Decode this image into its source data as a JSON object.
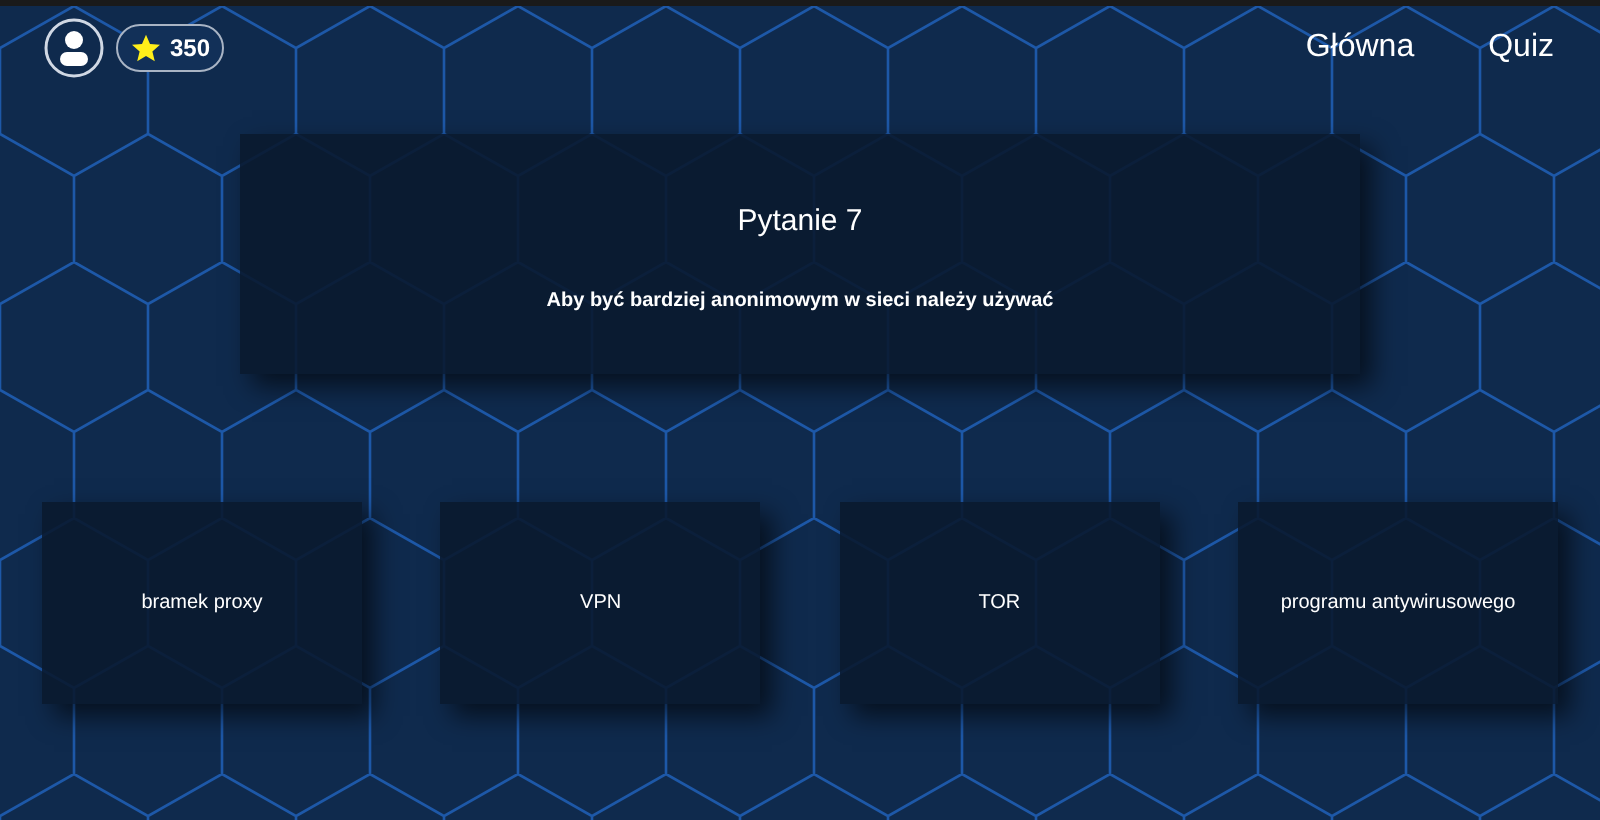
{
  "header": {
    "points": "350",
    "nav": [
      {
        "label": "Główna"
      },
      {
        "label": "Quiz"
      }
    ]
  },
  "question": {
    "title": "Pytanie 7",
    "text": "Aby być bardziej anonimowym w sieci należy używać"
  },
  "answers": [
    {
      "label": "bramek proxy"
    },
    {
      "label": "VPN"
    },
    {
      "label": "TOR"
    },
    {
      "label": "programu antywirusowego"
    }
  ]
}
